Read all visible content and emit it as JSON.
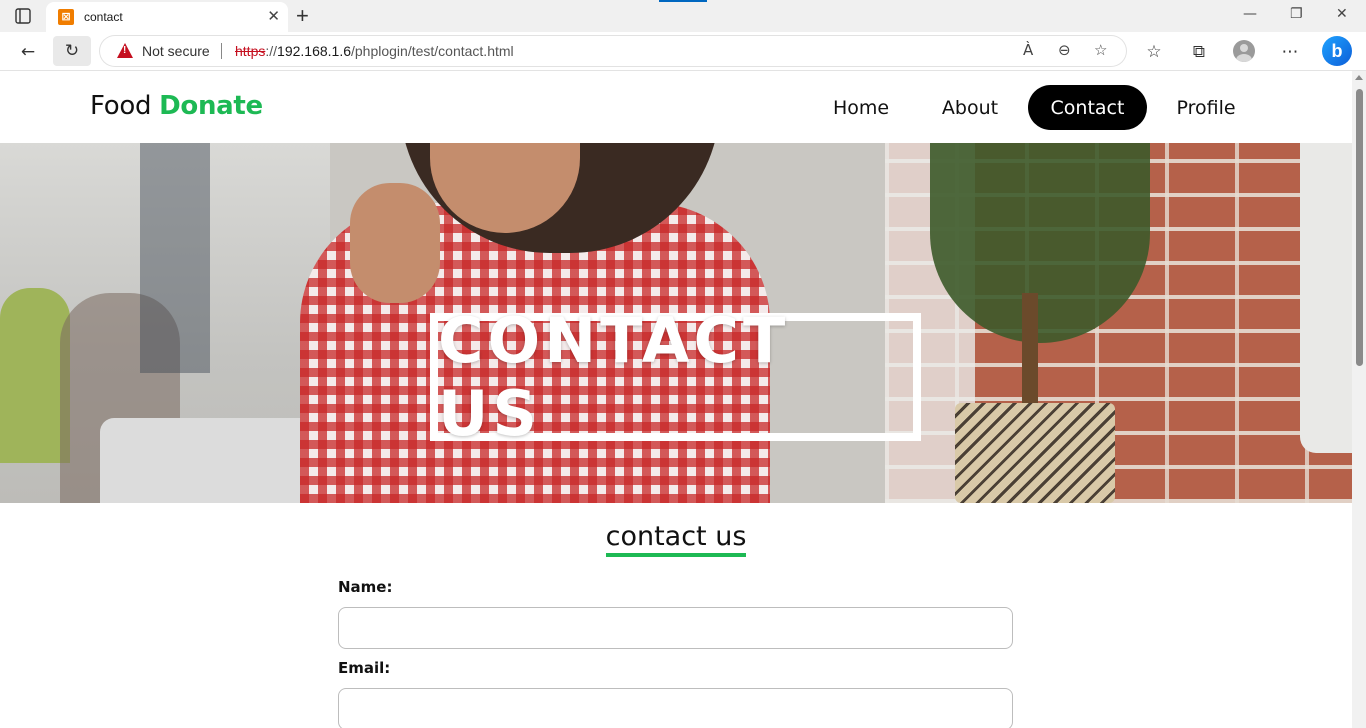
{
  "browser": {
    "tab_title": "contact",
    "favicon_glyph": "⊠",
    "new_tab_glyph": "+",
    "close_glyph": "✕",
    "security_label": "Not secure",
    "url_scheme": "https",
    "url_sep": "://",
    "url_host": "192.168.1.6",
    "url_path": "/phplogin/test/contact.html",
    "bing_glyph": "b",
    "icons": {
      "back": "←",
      "refresh": "↻",
      "read_aloud": "À",
      "zoom": "⊖",
      "favorite_add": "☆",
      "favorites": "☆",
      "collections": "⧉",
      "more": "⋯",
      "minimize": "—",
      "restore": "❐",
      "close": "✕"
    }
  },
  "site": {
    "logo_main": "Food ",
    "logo_accent": "Donate",
    "nav": [
      {
        "label": "Home"
      },
      {
        "label": "About"
      },
      {
        "label": "Contact"
      },
      {
        "label": "Profile"
      }
    ]
  },
  "hero": {
    "title": "CONTACT US"
  },
  "form": {
    "heading": "contact us",
    "name_label": "Name:",
    "email_label": "Email:",
    "name_value": "",
    "email_value": ""
  },
  "colors": {
    "accent": "#1db954",
    "nav_active_bg": "#000000",
    "warning": "#c50f1f"
  }
}
